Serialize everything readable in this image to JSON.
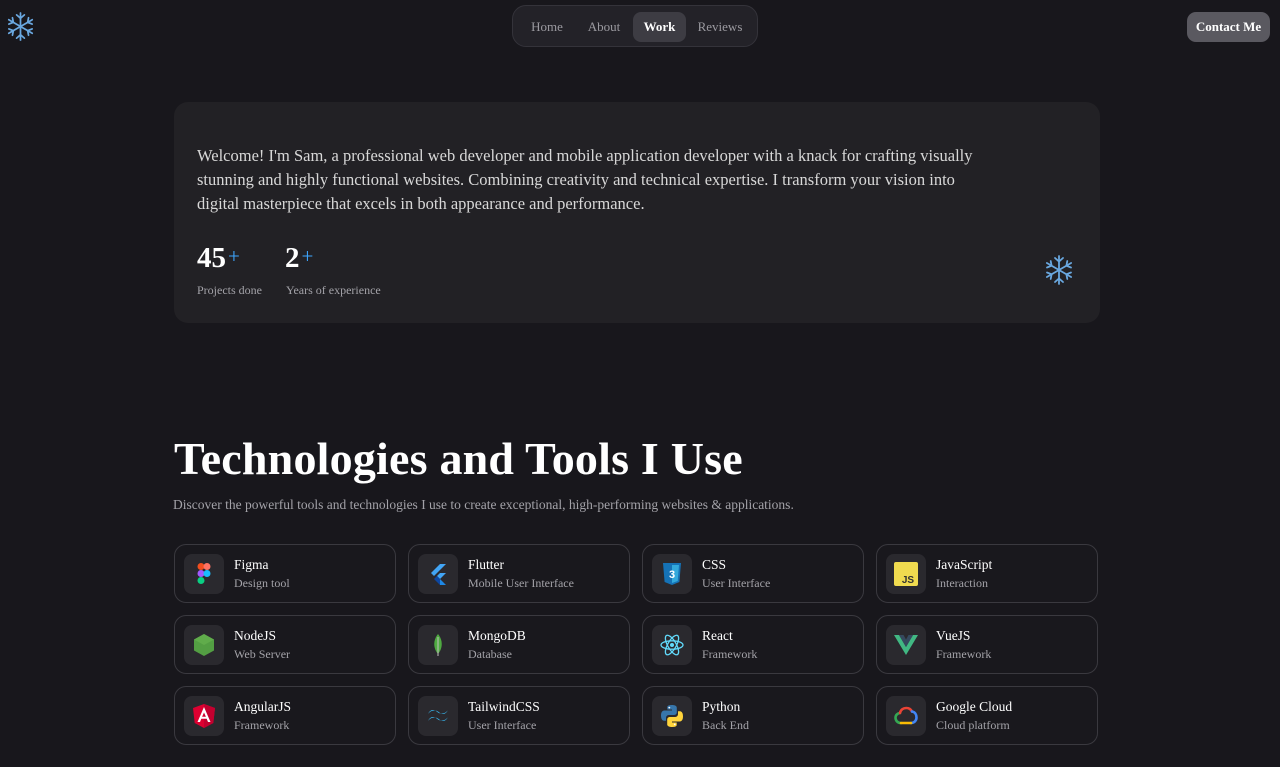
{
  "nav": {
    "items": [
      {
        "label": "Home",
        "active": false
      },
      {
        "label": "About",
        "active": false
      },
      {
        "label": "Work",
        "active": true
      },
      {
        "label": "Reviews",
        "active": false
      }
    ],
    "contact_label": "Contact Me",
    "logo_icon": "snowflake-icon"
  },
  "hero": {
    "intro": "Welcome! I'm Sam, a professional web developer and mobile application developer with a knack for crafting visually stunning and highly functional websites. Combining creativity and technical expertise. I transform your vision into digital masterpiece that excels in both appearance and performance.",
    "stats": [
      {
        "value": "45",
        "suffix": "+",
        "label": "Projects done"
      },
      {
        "value": "2",
        "suffix": "+",
        "label": "Years of experience"
      }
    ],
    "accent_color": "#3ea6ff"
  },
  "tools": {
    "title": "Technologies and Tools I Use",
    "subtitle": "Discover the powerful tools and technologies I use to create exceptional, high-performing websites & applications.",
    "items": [
      {
        "name": "Figma",
        "desc": "Design tool",
        "icon": "figma-icon"
      },
      {
        "name": "Flutter",
        "desc": "Mobile User Interface",
        "icon": "flutter-icon"
      },
      {
        "name": "CSS",
        "desc": "User Interface",
        "icon": "css-icon"
      },
      {
        "name": "JavaScript",
        "desc": "Interaction",
        "icon": "javascript-icon"
      },
      {
        "name": "NodeJS",
        "desc": "Web Server",
        "icon": "nodejs-icon"
      },
      {
        "name": "MongoDB",
        "desc": "Database",
        "icon": "mongodb-icon"
      },
      {
        "name": "React",
        "desc": "Framework",
        "icon": "react-icon"
      },
      {
        "name": "VueJS",
        "desc": "Framework",
        "icon": "vuejs-icon"
      },
      {
        "name": "AngularJS",
        "desc": "Framework",
        "icon": "angular-icon"
      },
      {
        "name": "TailwindCSS",
        "desc": "User Interface",
        "icon": "tailwind-icon"
      },
      {
        "name": "Python",
        "desc": "Back End",
        "icon": "python-icon"
      },
      {
        "name": "Google Cloud",
        "desc": "Cloud platform",
        "icon": "google-cloud-icon"
      }
    ]
  }
}
